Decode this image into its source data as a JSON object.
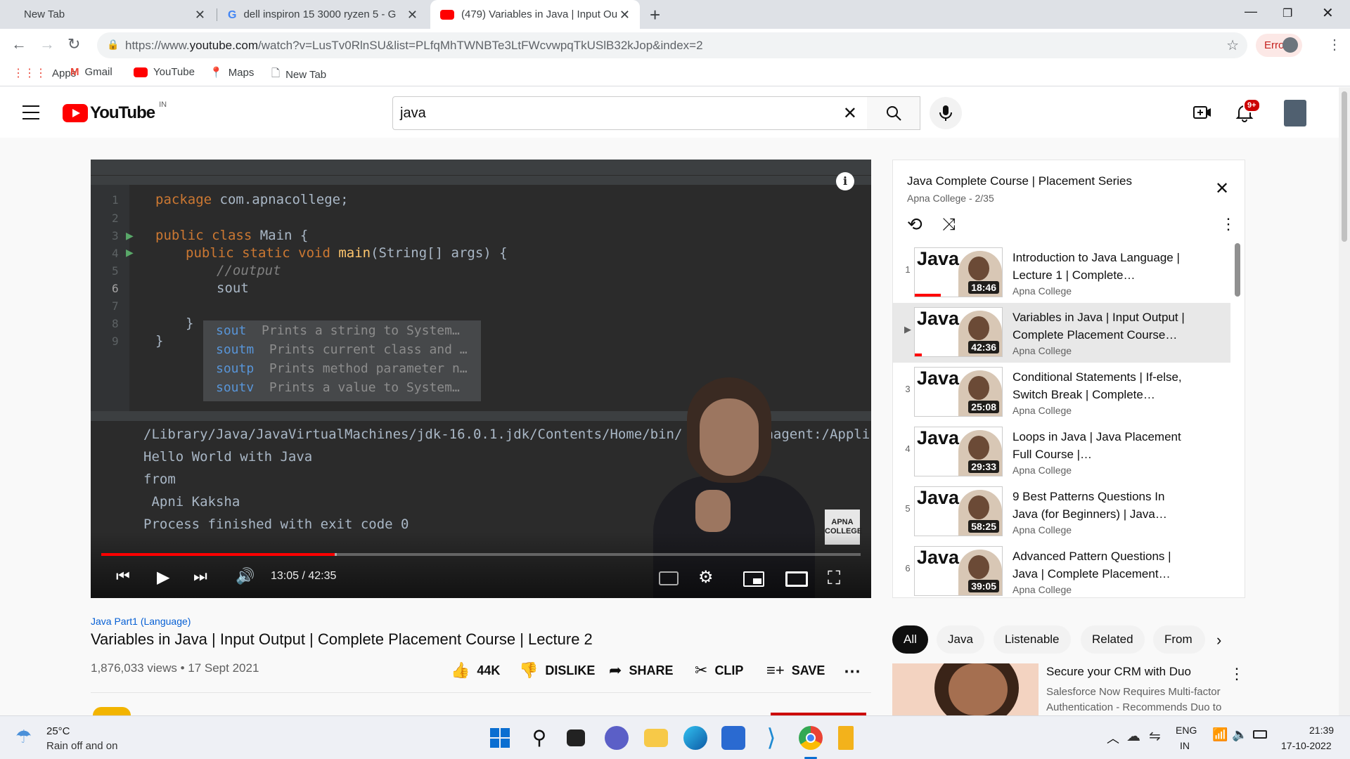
{
  "browser": {
    "tabs": [
      {
        "title": "New Tab"
      },
      {
        "title": "dell inspiron 15 3000 ryzen 5 - G"
      },
      {
        "title": "(479) Variables in Java | Input Ou"
      }
    ],
    "url_prefix": "https://www.",
    "url_host": "youtube.com",
    "url_rest": "/watch?v=LusTv0RlnSU&list=PLfqMhTWNBTe3LtFWcvwpqTkUSlB32kJop&index=2",
    "error_label": "Error",
    "bookmarks": [
      {
        "label": "Apps",
        "icon": "apps-grid-icon"
      },
      {
        "label": "Gmail",
        "icon": "gmail-icon"
      },
      {
        "label": "YouTube",
        "icon": "youtube-icon"
      },
      {
        "label": "Maps",
        "icon": "maps-icon"
      },
      {
        "label": "New Tab",
        "icon": "page-icon"
      }
    ]
  },
  "youtube": {
    "logo_text": "YouTube",
    "region": "IN",
    "search_value": "java",
    "notif_count": "9+"
  },
  "player": {
    "code_lines": {
      "l1_kw": "package ",
      "l1_rest": "com.apnacollege;",
      "l3_kw": "public class ",
      "l3_rest": "Main {",
      "l4_kw": "public static void ",
      "l4_fn": "main",
      "l4_rest": "(String[] args) {",
      "l5": "//output",
      "l6": "sout",
      "l8": "}",
      "l9": "}"
    },
    "popup": [
      {
        "key": "sout",
        "desc": "Prints a string to System…"
      },
      {
        "key": "soutm",
        "desc": "Prints current class and …"
      },
      {
        "key": "soutp",
        "desc": "Prints method parameter n…"
      },
      {
        "key": "soutv",
        "desc": "Prints a value to System…"
      }
    ],
    "console": [
      "/Library/Java/JavaVirtualMachines/jdk-16.0.1.jdk/Contents/Home/bin/",
      "Hello World with Java",
      "from",
      " Apni Kaksha",
      "Process finished with exit code 0"
    ],
    "console_tail": "vaagent:/Appli",
    "watermark": "APNA COLLEGE",
    "time": "13:05 / 42:35",
    "progress_played": 0.307,
    "progress_buffered": 0.29
  },
  "video": {
    "playlist_tag": "Java Part1 (Language)",
    "title": "Variables in Java | Input Output | Complete Placement Course | Lecture 2",
    "views_date": "1,876,033 views • 17 Sept 2021",
    "likes": "44K",
    "dislike": "DISLIKE",
    "share": "SHARE",
    "clip": "CLIP",
    "save": "SAVE"
  },
  "playlist": {
    "title": "Java Complete Course | Placement Series",
    "subtitle": "Apna College - 2/35",
    "items": [
      {
        "idx": "1",
        "title": "Introduction to Java Language | Lecture 1 | Complete…",
        "channel": "Apna College",
        "duration": "18:46",
        "thumb": "Java",
        "watched": 0.3
      },
      {
        "idx": "▶",
        "title": "Variables in Java | Input Output | Complete Placement Course…",
        "channel": "Apna College",
        "duration": "42:36",
        "thumb": "Java",
        "watched": 0.08
      },
      {
        "idx": "3",
        "title": "Conditional Statements | If-else, Switch Break | Complete…",
        "channel": "Apna College",
        "duration": "25:08",
        "thumb": "Java",
        "watched": 0
      },
      {
        "idx": "4",
        "title": "Loops in Java | Java Placement Full Course |…",
        "channel": "Apna College",
        "duration": "29:33",
        "thumb": "Java",
        "watched": 0
      },
      {
        "idx": "5",
        "title": "9 Best Patterns Questions In Java (for Beginners) | Java…",
        "channel": "Apna College",
        "duration": "58:25",
        "thumb": "Java",
        "watched": 0
      },
      {
        "idx": "6",
        "title": "Advanced Pattern Questions | Java | Complete Placement…",
        "channel": "Apna College",
        "duration": "39:05",
        "thumb": "Java",
        "watched": 0
      }
    ]
  },
  "chips": [
    "All",
    "Java",
    "Listenable",
    "Related",
    "From"
  ],
  "ad": {
    "title": "Secure your CRM with Duo",
    "desc": "Salesforce Now Requires Multi-factor Authentication - Recommends Duo to"
  },
  "taskbar": {
    "temp": "25°C",
    "weather": "Rain off and on",
    "lang1": "ENG",
    "lang2": "IN",
    "time": "21:39",
    "date": "17-10-2022"
  },
  "colors": {
    "accent_red": "#ff0000",
    "link_blue": "#065fd4"
  }
}
